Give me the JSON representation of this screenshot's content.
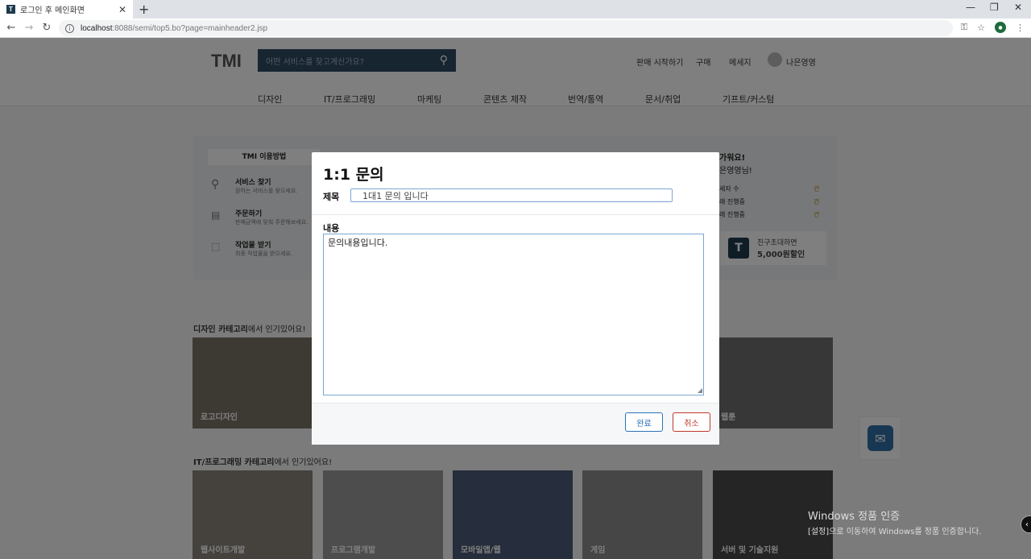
{
  "browser": {
    "tab_title": "로그인 후 메인화면",
    "tab_favicon": "T",
    "url_host": "localhost",
    "url_path": ":8088/semi/top5.bo?page=mainheader2.jsp"
  },
  "header": {
    "logo": "TMI",
    "search_placeholder": "어떤 서비스를 찾고계신가요?",
    "links": [
      "판매 시작하기",
      "구매",
      "메세지"
    ],
    "username": "나은영영"
  },
  "categories": [
    "디자인",
    "IT/프로그래밍",
    "마케팅",
    "콘텐츠 제작",
    "번역/통역",
    "문서/취업",
    "기프트/커스텀"
  ],
  "banner": {
    "guide_title": "TMI 이용방법",
    "guides": [
      {
        "title": "서비스 찾기",
        "desc": "원하는 서비스를 찾으세요."
      },
      {
        "title": "주문하기",
        "desc": "판매금액에 맞춰 주문해보세요."
      },
      {
        "title": "작업물 받기",
        "desc": "최종 작업물을 받으세요."
      }
    ],
    "greeting": "가워요!",
    "greeting_name": "은영영님!",
    "stats": [
      {
        "label": "세자 수",
        "value": "건"
      },
      {
        "label": "래 진행중",
        "value": "건"
      },
      {
        "label": "래 진행중",
        "value": "건"
      }
    ],
    "invite_logo": "T",
    "invite_line1": "친구초대하면",
    "invite_amount": "5,000원",
    "invite_suffix": "할인"
  },
  "sections": [
    {
      "title_bold": "디자인 카테고리",
      "title_rest": "에서 인기있어요!",
      "cards": [
        "로고디자인",
        "웹툰"
      ]
    },
    {
      "title_bold": "IT/프로그래밍 카테고리",
      "title_rest": "에서 인기있어요!",
      "cards": [
        "웹사이트개발",
        "프로그램개발",
        "모바일앱/웹",
        "게임",
        "서버 및 기술지원"
      ]
    }
  ],
  "modal": {
    "title": "1:1 문의",
    "subject_label": "제목",
    "subject_value": "1대1 문의 입니다",
    "content_label": "내용",
    "content_value": "문의내용입니다.",
    "ok_label": "완료",
    "cancel_label": "취소"
  },
  "watermark": {
    "line1": "Windows 정품 인증",
    "line2": "[설정]으로 이동하여 Windows를 정품 인증합니다."
  }
}
